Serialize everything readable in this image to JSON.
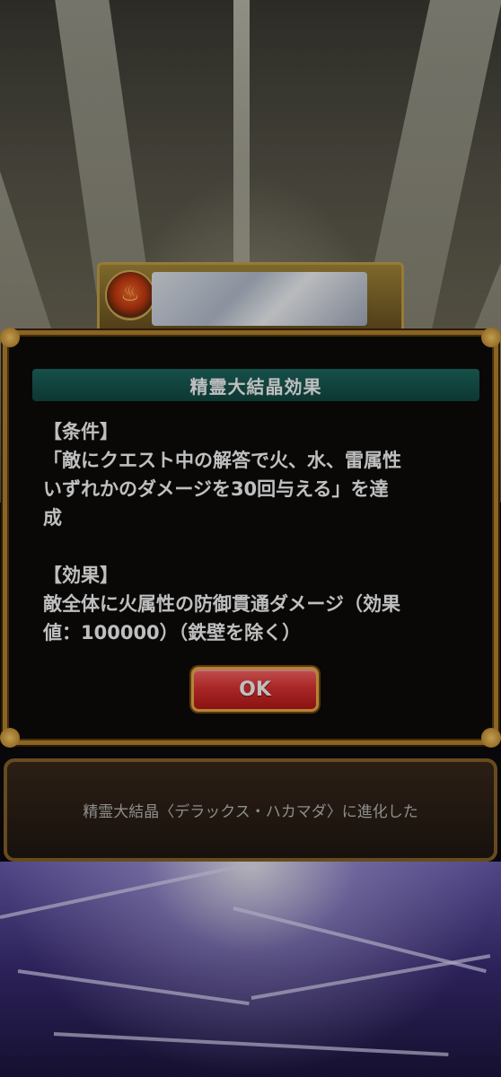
{
  "dialog": {
    "title": "精霊大結晶効果",
    "condition_heading": "【条件】",
    "condition_lines": [
      "「敵にクエスト中の解答で火、水、雷属性",
      "いずれかのダメージを30回与える」を達",
      "成"
    ],
    "effect_heading": "【効果】",
    "effect_lines": [
      "敵全体に火属性の防御貫通ダメージ（効果",
      "値：100000）（鉄壁を除く）"
    ],
    "ok_label": "OK"
  },
  "evolution_message": "精霊大結晶〈デラックス・ハカマダ〉に進化した",
  "icons": {
    "emblem": "fire-attribute-emblem-icon"
  },
  "colors": {
    "title_bar": "#1f6a62",
    "dialog_border": "#b8862f",
    "ok_button": "#e43434"
  }
}
